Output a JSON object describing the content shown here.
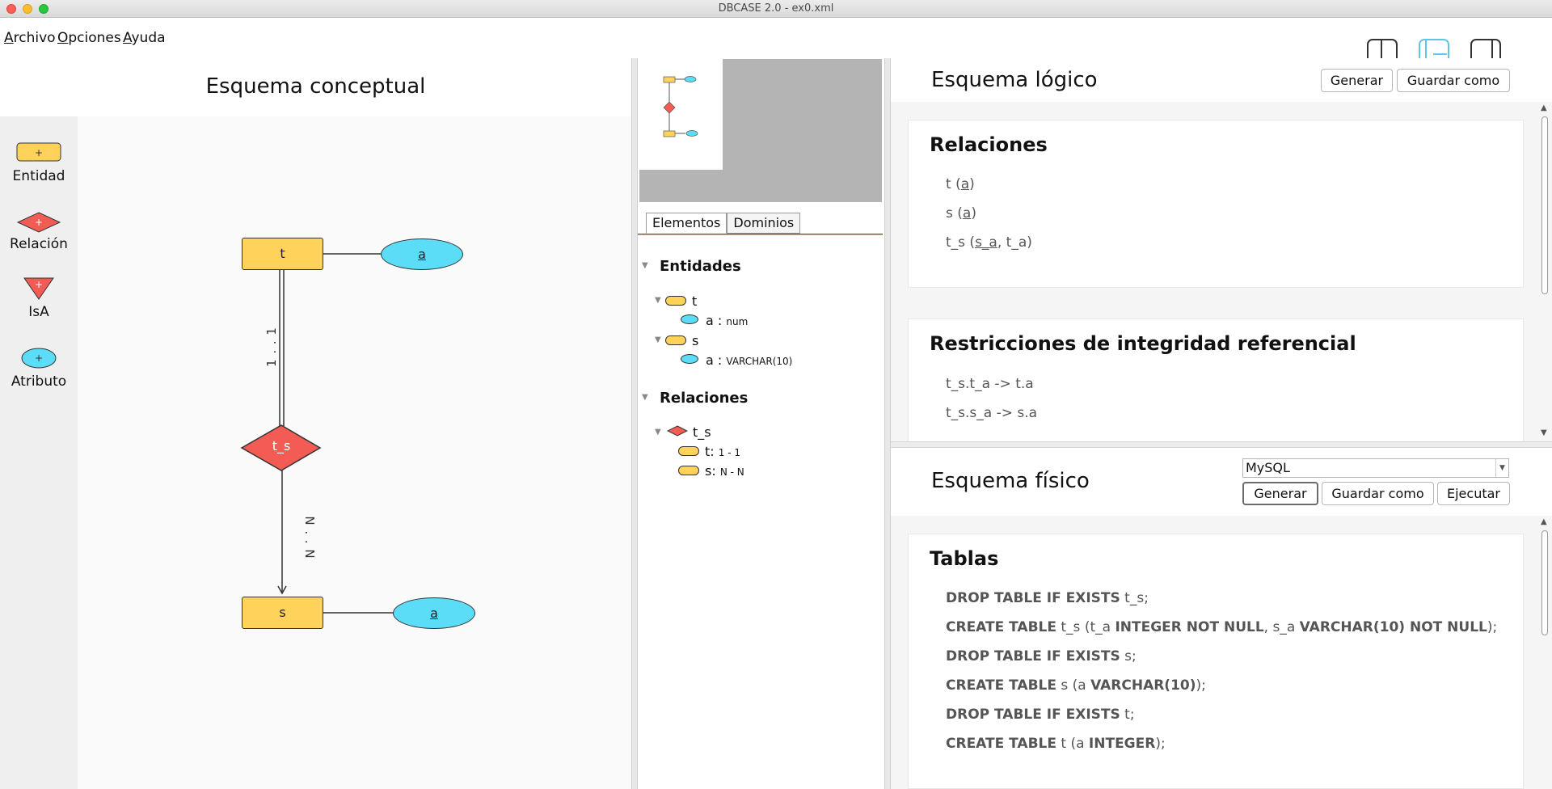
{
  "window": {
    "title": "DBCASE 2.0 - ex0.xml"
  },
  "menu": {
    "archivo": "Archivo",
    "opciones": "Opciones",
    "ayuda": "Ayuda"
  },
  "view_buttons": {
    "active": "center",
    "accent": "#5bc8e8"
  },
  "conceptual": {
    "title": "Esquema conceptual",
    "palette": [
      "Entidad",
      "Relación",
      "IsA",
      "Atributo"
    ],
    "diagram": {
      "entities": [
        {
          "name": "t",
          "attr": "a"
        },
        {
          "name": "s",
          "attr": "a"
        }
      ],
      "relation": {
        "name": "t_s",
        "card_top": "1 . . 1",
        "card_bottom": "N . . N"
      },
      "colors": {
        "entity": "#ffd35a",
        "relation": "#f25c54",
        "attribute": "#5bdcf7"
      }
    }
  },
  "elements": {
    "tabs": [
      "Elementos",
      "Dominios"
    ],
    "entities_header": "Entidades",
    "entities": [
      {
        "name": "t",
        "attr": "a",
        "sep": ":",
        "type": "num"
      },
      {
        "name": "s",
        "attr": "a",
        "sep": ":",
        "type": "VARCHAR(10)"
      }
    ],
    "relations_header": "Relaciones",
    "relations": [
      {
        "name": "t_s",
        "links": [
          {
            "ent": "t:",
            "card": "1 - 1"
          },
          {
            "ent": "s:",
            "card": "N - N"
          }
        ]
      }
    ]
  },
  "logical": {
    "title": "Esquema lógico",
    "generate": "Generar",
    "save_as": "Guardar como",
    "relations_title": "Relaciones",
    "restrictions_title": "Restricciones de integridad referencial",
    "restrictions": [
      "t_s.t_a -> t.a",
      "t_s.s_a -> s.a"
    ]
  },
  "physical": {
    "title": "Esquema físico",
    "dbms": "MySQL",
    "generate": "Generar",
    "save_as": "Guardar como",
    "execute": "Ejecutar",
    "tables_title": "Tablas"
  }
}
